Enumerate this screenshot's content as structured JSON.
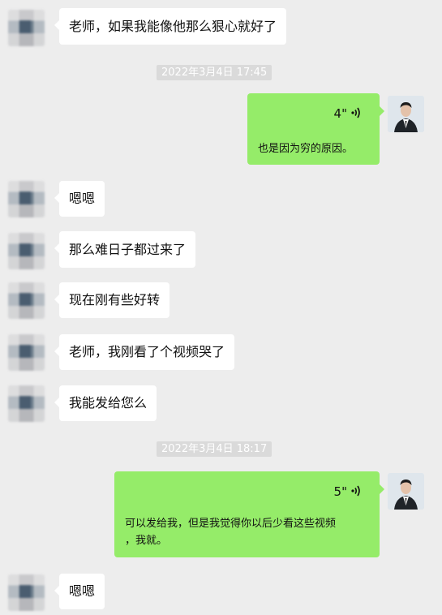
{
  "messages": {
    "m1": "老师，如果我能像他那么狠心就好了",
    "ts1": "2022年3月4日 17:45",
    "voice1": {
      "duration": "4\"",
      "transcript": "也是因为穷的原因。"
    },
    "m2": "嗯嗯",
    "m3": "那么难日子都过来了",
    "m4": "现在刚有些好转",
    "m5": "老师，我刚看了个视频哭了",
    "m6": "我能发给您么",
    "ts2": "2022年3月4日 18:17",
    "voice2": {
      "duration": "5\"",
      "transcript_line1": "可以发给我，但是我觉得你以后少看这些视频",
      "transcript_line2": "，我就。"
    },
    "m7": "嗯嗯"
  },
  "colors": {
    "background": "#ededed",
    "my_bubble": "#95ec69",
    "their_bubble": "#ffffff",
    "timestamp_bg": "#dadada"
  },
  "icons": {
    "voice": "voice-wave-icon",
    "avatar_other": "avatar-pixelated",
    "avatar_me": "avatar-man-in-suit"
  }
}
